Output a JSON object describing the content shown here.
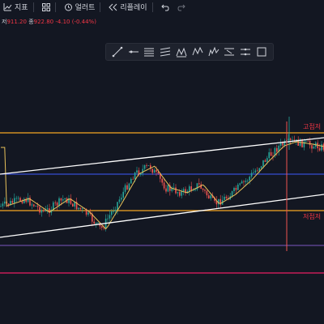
{
  "toolbar": {
    "indicators_label": "지표",
    "alert_label": "얼러트",
    "replay_label": "리플레이"
  },
  "ohlc": {
    "low_label": "저",
    "low_value": "911.20",
    "close_label": "종",
    "close_value": "922.80",
    "change": "-4.10 (-0.44%)"
  },
  "drawing_tools": [
    "trend-line",
    "horizontal-ray",
    "parallel-channel",
    "regression-trend",
    "flat-top-bottom",
    "xabcd-pattern",
    "elliott-wave",
    "date-range",
    "price-range",
    "rectangle"
  ],
  "labels": {
    "high_level": "고점저",
    "low_level": "저점저"
  },
  "colors": {
    "background": "#131722",
    "up": "#26a69a",
    "down": "#ef5350",
    "orange_line": "#f5a623",
    "blue_line": "#3d5afe",
    "purple_line": "#7e57c2",
    "pink_line": "#e91e63",
    "channel": "#ffffff",
    "ma": "#e8c15a",
    "label_red": "#f23645"
  }
}
